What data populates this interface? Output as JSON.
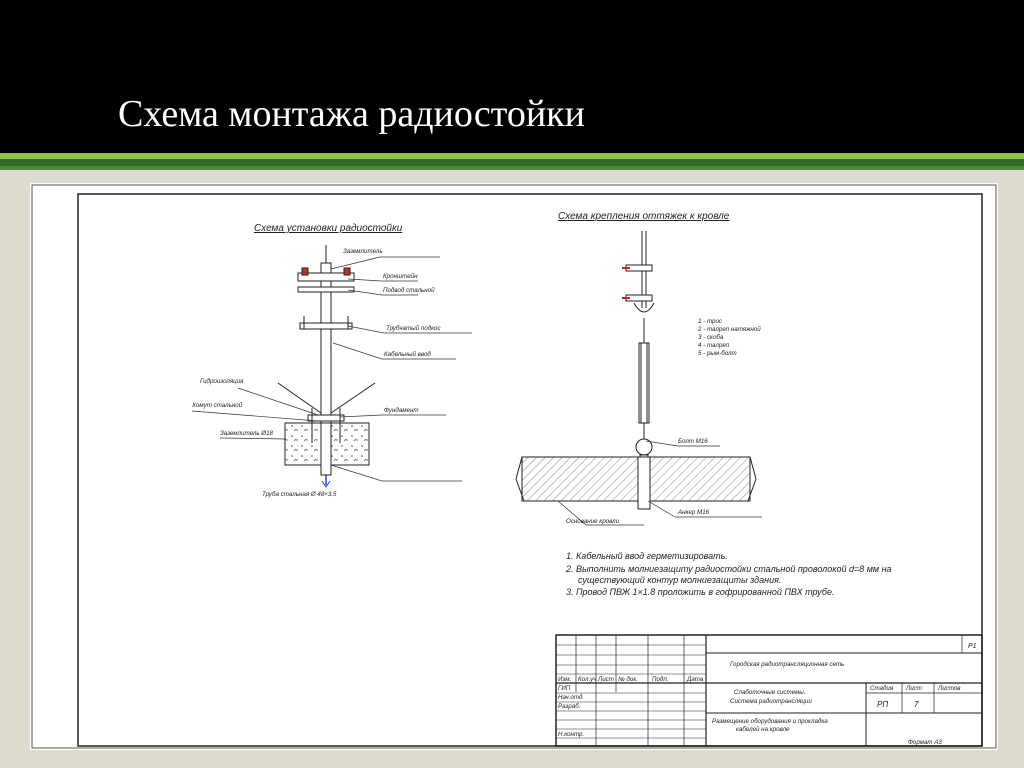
{
  "slide": {
    "title": "Схема монтажа радиостойки"
  },
  "drawing": {
    "left_view_title": "Схема установки радиостойки",
    "right_view_title": "Схема крепления оттяжек к кровле",
    "left_labels": [
      "Заземлитель",
      "Кронштейн",
      "Подвод стальной",
      "Трубчатый подкос",
      "Кабельный ввод",
      "Гидроизоляция",
      "Хомут стальной",
      "Фундамент",
      "Заземлитель Ø18"
    ],
    "left_bottom_caption": "Труба стальная Ø 48×3.5",
    "legend_items": [
      "1 - трос",
      "2 - талреп натяжной",
      "3 - скоба",
      "4 - талреп",
      "5 - рым-болт"
    ],
    "right_labels": [
      "Болт М16",
      "Анкер М16",
      "Основание кровли"
    ],
    "notes": [
      "1. Кабельный ввод герметизировать.",
      "2. Выполнить молниезащиту радиостойки стальной проволокой d=8 мм на",
      "существующий контур молниезащиты здания.",
      "3. Провод ПВЖ 1×1.8 проложить в гофрированной ПВХ трубе."
    ],
    "title_block": {
      "row_headers": [
        "Изм.",
        "Кол.уч",
        "Лист",
        "№ док.",
        "Подп.",
        "Дата"
      ],
      "roles": [
        "ГИП",
        "Нач.отд.",
        "Разраб.",
        "Н.контр."
      ],
      "object_line": "Городская радиотрансляционная сеть",
      "doc_title_lines": [
        "Слаботочные системы.",
        "Система радиотрансляции"
      ],
      "sheet_title_lines": [
        "Размещение оборудования и прокладка",
        "кабелей на кровле"
      ],
      "stage_header": "Стадия",
      "sheet_header": "Лист",
      "sheets_header": "Листов",
      "stage": "РП",
      "sheet": "7",
      "sheet_number_corner": "Р1",
      "format": "Формат А3"
    }
  }
}
